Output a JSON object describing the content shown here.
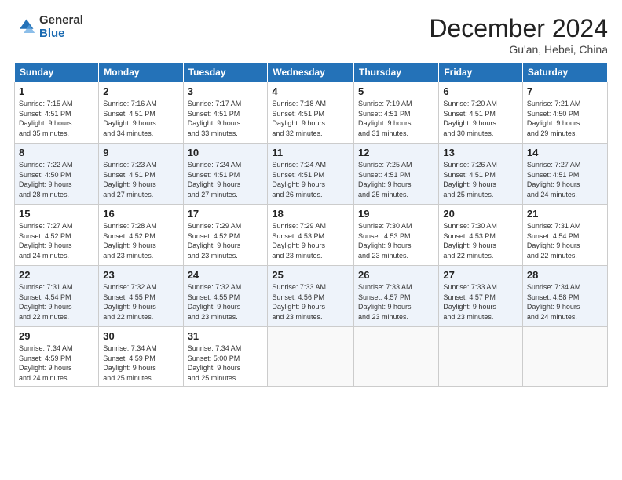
{
  "logo": {
    "general": "General",
    "blue": "Blue"
  },
  "header": {
    "month": "December 2024",
    "location": "Gu'an, Hebei, China"
  },
  "weekdays": [
    "Sunday",
    "Monday",
    "Tuesday",
    "Wednesday",
    "Thursday",
    "Friday",
    "Saturday"
  ],
  "weeks": [
    [
      {
        "day": "1",
        "info": "Sunrise: 7:15 AM\nSunset: 4:51 PM\nDaylight: 9 hours\nand 35 minutes."
      },
      {
        "day": "2",
        "info": "Sunrise: 7:16 AM\nSunset: 4:51 PM\nDaylight: 9 hours\nand 34 minutes."
      },
      {
        "day": "3",
        "info": "Sunrise: 7:17 AM\nSunset: 4:51 PM\nDaylight: 9 hours\nand 33 minutes."
      },
      {
        "day": "4",
        "info": "Sunrise: 7:18 AM\nSunset: 4:51 PM\nDaylight: 9 hours\nand 32 minutes."
      },
      {
        "day": "5",
        "info": "Sunrise: 7:19 AM\nSunset: 4:51 PM\nDaylight: 9 hours\nand 31 minutes."
      },
      {
        "day": "6",
        "info": "Sunrise: 7:20 AM\nSunset: 4:51 PM\nDaylight: 9 hours\nand 30 minutes."
      },
      {
        "day": "7",
        "info": "Sunrise: 7:21 AM\nSunset: 4:50 PM\nDaylight: 9 hours\nand 29 minutes."
      }
    ],
    [
      {
        "day": "8",
        "info": "Sunrise: 7:22 AM\nSunset: 4:50 PM\nDaylight: 9 hours\nand 28 minutes."
      },
      {
        "day": "9",
        "info": "Sunrise: 7:23 AM\nSunset: 4:51 PM\nDaylight: 9 hours\nand 27 minutes."
      },
      {
        "day": "10",
        "info": "Sunrise: 7:24 AM\nSunset: 4:51 PM\nDaylight: 9 hours\nand 27 minutes."
      },
      {
        "day": "11",
        "info": "Sunrise: 7:24 AM\nSunset: 4:51 PM\nDaylight: 9 hours\nand 26 minutes."
      },
      {
        "day": "12",
        "info": "Sunrise: 7:25 AM\nSunset: 4:51 PM\nDaylight: 9 hours\nand 25 minutes."
      },
      {
        "day": "13",
        "info": "Sunrise: 7:26 AM\nSunset: 4:51 PM\nDaylight: 9 hours\nand 25 minutes."
      },
      {
        "day": "14",
        "info": "Sunrise: 7:27 AM\nSunset: 4:51 PM\nDaylight: 9 hours\nand 24 minutes."
      }
    ],
    [
      {
        "day": "15",
        "info": "Sunrise: 7:27 AM\nSunset: 4:52 PM\nDaylight: 9 hours\nand 24 minutes."
      },
      {
        "day": "16",
        "info": "Sunrise: 7:28 AM\nSunset: 4:52 PM\nDaylight: 9 hours\nand 23 minutes."
      },
      {
        "day": "17",
        "info": "Sunrise: 7:29 AM\nSunset: 4:52 PM\nDaylight: 9 hours\nand 23 minutes."
      },
      {
        "day": "18",
        "info": "Sunrise: 7:29 AM\nSunset: 4:53 PM\nDaylight: 9 hours\nand 23 minutes."
      },
      {
        "day": "19",
        "info": "Sunrise: 7:30 AM\nSunset: 4:53 PM\nDaylight: 9 hours\nand 23 minutes."
      },
      {
        "day": "20",
        "info": "Sunrise: 7:30 AM\nSunset: 4:53 PM\nDaylight: 9 hours\nand 22 minutes."
      },
      {
        "day": "21",
        "info": "Sunrise: 7:31 AM\nSunset: 4:54 PM\nDaylight: 9 hours\nand 22 minutes."
      }
    ],
    [
      {
        "day": "22",
        "info": "Sunrise: 7:31 AM\nSunset: 4:54 PM\nDaylight: 9 hours\nand 22 minutes."
      },
      {
        "day": "23",
        "info": "Sunrise: 7:32 AM\nSunset: 4:55 PM\nDaylight: 9 hours\nand 22 minutes."
      },
      {
        "day": "24",
        "info": "Sunrise: 7:32 AM\nSunset: 4:55 PM\nDaylight: 9 hours\nand 23 minutes."
      },
      {
        "day": "25",
        "info": "Sunrise: 7:33 AM\nSunset: 4:56 PM\nDaylight: 9 hours\nand 23 minutes."
      },
      {
        "day": "26",
        "info": "Sunrise: 7:33 AM\nSunset: 4:57 PM\nDaylight: 9 hours\nand 23 minutes."
      },
      {
        "day": "27",
        "info": "Sunrise: 7:33 AM\nSunset: 4:57 PM\nDaylight: 9 hours\nand 23 minutes."
      },
      {
        "day": "28",
        "info": "Sunrise: 7:34 AM\nSunset: 4:58 PM\nDaylight: 9 hours\nand 24 minutes."
      }
    ],
    [
      {
        "day": "29",
        "info": "Sunrise: 7:34 AM\nSunset: 4:59 PM\nDaylight: 9 hours\nand 24 minutes."
      },
      {
        "day": "30",
        "info": "Sunrise: 7:34 AM\nSunset: 4:59 PM\nDaylight: 9 hours\nand 25 minutes."
      },
      {
        "day": "31",
        "info": "Sunrise: 7:34 AM\nSunset: 5:00 PM\nDaylight: 9 hours\nand 25 minutes."
      },
      null,
      null,
      null,
      null
    ]
  ]
}
